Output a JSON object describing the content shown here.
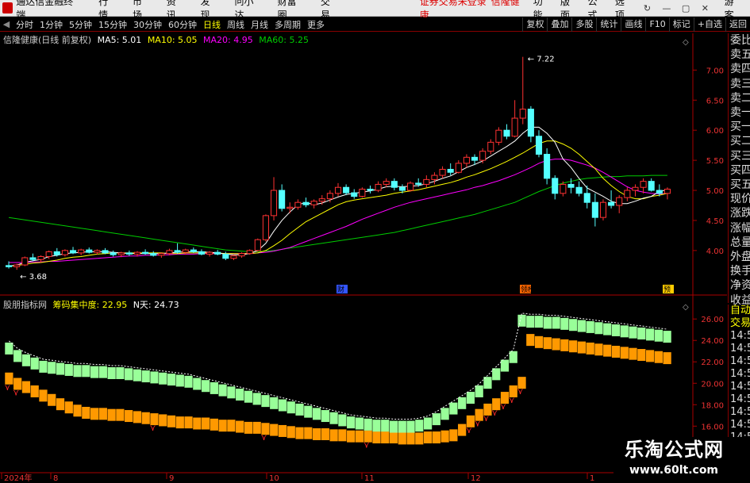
{
  "app": {
    "title": "通达信金融终端",
    "notice": [
      "证券交易未登录",
      "信隆健康"
    ],
    "guest": "游客"
  },
  "menu": [
    "行情",
    "市场",
    "资讯",
    "发现",
    "问小达",
    "财富圈",
    "交易"
  ],
  "menu_right": [
    "功能",
    "版面",
    "公式",
    "选项"
  ],
  "window_buttons": [
    "↻",
    "—",
    "▢",
    "✕"
  ],
  "periods": [
    "分时",
    "1分钟",
    "5分钟",
    "15分钟",
    "30分钟",
    "60分钟",
    "日线",
    "周线",
    "月线",
    "多周期",
    "更多"
  ],
  "active_period": "日线",
  "toolbar_right": [
    "复权",
    "叠加",
    "多股",
    "统计",
    "画线",
    "F10",
    "标记",
    "+自选",
    "返回"
  ],
  "main_info": {
    "name": "信隆健康(日线 前复权)",
    "ma5": "MA5: 5.01",
    "ma10": "MA10: 5.05",
    "ma20": "MA20: 4.95",
    "ma60": "MA60: 5.25"
  },
  "sub_info": {
    "name": "股朋指标网",
    "chip": "筹码集中度: 22.95",
    "nday": "N天: 24.73"
  },
  "order_panel": [
    "委比",
    "卖五",
    "卖四",
    "卖三",
    "卖二",
    "卖一",
    "买一",
    "买二",
    "买三",
    "买四",
    "买五",
    "现价",
    "涨跌",
    "涨幅",
    "总量",
    "外盘",
    "换手",
    "净资",
    "收益"
  ],
  "side_panel2": [
    "自动",
    "交易",
    "14:56",
    "14:56",
    "14:56",
    "14:56",
    "14:56",
    "14:56",
    "14:56",
    "14:56",
    "14:56"
  ],
  "price_axis": [
    "7.00",
    "6.50",
    "6.00",
    "5.50",
    "5.00",
    "4.50",
    "4.00"
  ],
  "sub_axis": [
    "26.00",
    "24.00",
    "22.00",
    "20.00",
    "18.00",
    "16.00"
  ],
  "time_axis": [
    "2024年",
    "8",
    "9",
    "10",
    "11",
    "12",
    "1"
  ],
  "annotations": {
    "high": "7.22",
    "low": "3.68",
    "m1": "财",
    "m2": "领榜",
    "m3": "预"
  },
  "watermark": {
    "line1": "乐淘公式网",
    "line2": "www.60lt.com"
  },
  "colors": {
    "up": "#ff3232",
    "down": "#54ffff",
    "ma5": "#ffffff",
    "ma10": "#ffff00",
    "ma20": "#ff00ff",
    "ma60": "#00cc00",
    "bar_orange": "#ff9900",
    "bar_green": "#99ff99"
  },
  "chart_data": {
    "type": "candlestick",
    "price_range": [
      3.55,
      7.4
    ],
    "candles": [
      {
        "o": 3.75,
        "h": 3.82,
        "l": 3.7,
        "c": 3.73
      },
      {
        "o": 3.73,
        "h": 3.78,
        "l": 3.68,
        "c": 3.76
      },
      {
        "o": 3.76,
        "h": 3.9,
        "l": 3.74,
        "c": 3.88
      },
      {
        "o": 3.88,
        "h": 3.95,
        "l": 3.82,
        "c": 3.85
      },
      {
        "o": 3.85,
        "h": 3.92,
        "l": 3.8,
        "c": 3.9
      },
      {
        "o": 3.9,
        "h": 4.0,
        "l": 3.86,
        "c": 3.98
      },
      {
        "o": 3.98,
        "h": 4.04,
        "l": 3.9,
        "c": 3.93
      },
      {
        "o": 3.93,
        "h": 4.02,
        "l": 3.9,
        "c": 4.0
      },
      {
        "o": 4.0,
        "h": 4.06,
        "l": 3.94,
        "c": 3.96
      },
      {
        "o": 3.96,
        "h": 4.03,
        "l": 3.92,
        "c": 4.01
      },
      {
        "o": 4.01,
        "h": 4.05,
        "l": 3.95,
        "c": 3.97
      },
      {
        "o": 3.97,
        "h": 4.02,
        "l": 3.93,
        "c": 4.0
      },
      {
        "o": 4.0,
        "h": 4.04,
        "l": 3.94,
        "c": 3.96
      },
      {
        "o": 3.96,
        "h": 4.0,
        "l": 3.9,
        "c": 3.93
      },
      {
        "o": 3.93,
        "h": 3.98,
        "l": 3.89,
        "c": 3.96
      },
      {
        "o": 3.96,
        "h": 4.0,
        "l": 3.91,
        "c": 3.94
      },
      {
        "o": 3.94,
        "h": 3.99,
        "l": 3.9,
        "c": 3.97
      },
      {
        "o": 3.97,
        "h": 4.02,
        "l": 3.93,
        "c": 3.95
      },
      {
        "o": 3.95,
        "h": 3.99,
        "l": 3.9,
        "c": 3.92
      },
      {
        "o": 3.92,
        "h": 3.97,
        "l": 3.88,
        "c": 3.95
      },
      {
        "o": 3.95,
        "h": 4.03,
        "l": 3.92,
        "c": 4.0
      },
      {
        "o": 4.0,
        "h": 4.12,
        "l": 3.95,
        "c": 3.97
      },
      {
        "o": 3.97,
        "h": 4.03,
        "l": 3.93,
        "c": 4.01
      },
      {
        "o": 4.01,
        "h": 4.05,
        "l": 3.96,
        "c": 3.98
      },
      {
        "o": 3.98,
        "h": 4.02,
        "l": 3.92,
        "c": 3.94
      },
      {
        "o": 3.94,
        "h": 3.99,
        "l": 3.9,
        "c": 3.97
      },
      {
        "o": 3.97,
        "h": 4.01,
        "l": 3.92,
        "c": 3.94
      },
      {
        "o": 3.94,
        "h": 3.98,
        "l": 3.84,
        "c": 3.87
      },
      {
        "o": 3.87,
        "h": 3.93,
        "l": 3.84,
        "c": 3.91
      },
      {
        "o": 3.91,
        "h": 3.97,
        "l": 3.88,
        "c": 3.95
      },
      {
        "o": 3.95,
        "h": 4.02,
        "l": 3.93,
        "c": 4.0
      },
      {
        "o": 4.0,
        "h": 4.2,
        "l": 3.98,
        "c": 4.18
      },
      {
        "o": 4.18,
        "h": 4.6,
        "l": 4.15,
        "c": 4.58
      },
      {
        "o": 4.58,
        "h": 5.22,
        "l": 4.5,
        "c": 5.0
      },
      {
        "o": 5.0,
        "h": 5.1,
        "l": 4.65,
        "c": 4.7
      },
      {
        "o": 4.7,
        "h": 4.8,
        "l": 4.62,
        "c": 4.72
      },
      {
        "o": 4.72,
        "h": 4.85,
        "l": 4.68,
        "c": 4.8
      },
      {
        "o": 4.8,
        "h": 4.88,
        "l": 4.72,
        "c": 4.76
      },
      {
        "o": 4.76,
        "h": 4.85,
        "l": 4.7,
        "c": 4.82
      },
      {
        "o": 4.82,
        "h": 4.92,
        "l": 4.76,
        "c": 4.86
      },
      {
        "o": 4.86,
        "h": 5.0,
        "l": 4.8,
        "c": 4.95
      },
      {
        "o": 4.95,
        "h": 5.12,
        "l": 4.9,
        "c": 5.05
      },
      {
        "o": 5.05,
        "h": 5.1,
        "l": 4.92,
        "c": 4.96
      },
      {
        "o": 4.96,
        "h": 5.02,
        "l": 4.86,
        "c": 4.9
      },
      {
        "o": 4.9,
        "h": 5.05,
        "l": 4.88,
        "c": 5.02
      },
      {
        "o": 5.02,
        "h": 5.08,
        "l": 4.95,
        "c": 5.0
      },
      {
        "o": 5.0,
        "h": 5.15,
        "l": 4.97,
        "c": 5.1
      },
      {
        "o": 5.1,
        "h": 5.2,
        "l": 5.05,
        "c": 5.15
      },
      {
        "o": 5.15,
        "h": 5.2,
        "l": 5.0,
        "c": 5.05
      },
      {
        "o": 5.05,
        "h": 5.1,
        "l": 4.95,
        "c": 5.0
      },
      {
        "o": 5.0,
        "h": 5.15,
        "l": 4.98,
        "c": 5.12
      },
      {
        "o": 5.12,
        "h": 5.2,
        "l": 5.06,
        "c": 5.1
      },
      {
        "o": 5.1,
        "h": 5.25,
        "l": 5.05,
        "c": 5.18
      },
      {
        "o": 5.18,
        "h": 5.3,
        "l": 5.1,
        "c": 5.25
      },
      {
        "o": 5.25,
        "h": 5.4,
        "l": 5.2,
        "c": 5.35
      },
      {
        "o": 5.35,
        "h": 5.45,
        "l": 5.25,
        "c": 5.3
      },
      {
        "o": 5.3,
        "h": 5.5,
        "l": 5.28,
        "c": 5.45
      },
      {
        "o": 5.45,
        "h": 5.6,
        "l": 5.38,
        "c": 5.55
      },
      {
        "o": 5.55,
        "h": 5.6,
        "l": 5.42,
        "c": 5.5
      },
      {
        "o": 5.5,
        "h": 5.7,
        "l": 5.45,
        "c": 5.65
      },
      {
        "o": 5.65,
        "h": 5.85,
        "l": 5.6,
        "c": 5.8
      },
      {
        "o": 5.8,
        "h": 6.05,
        "l": 5.75,
        "c": 6.0
      },
      {
        "o": 6.0,
        "h": 6.1,
        "l": 5.85,
        "c": 5.9
      },
      {
        "o": 5.9,
        "h": 6.5,
        "l": 5.88,
        "c": 6.2
      },
      {
        "o": 6.2,
        "h": 7.22,
        "l": 6.1,
        "c": 6.35
      },
      {
        "o": 6.35,
        "h": 6.4,
        "l": 5.8,
        "c": 5.9
      },
      {
        "o": 5.9,
        "h": 6.0,
        "l": 5.55,
        "c": 5.6
      },
      {
        "o": 5.6,
        "h": 5.7,
        "l": 5.1,
        "c": 5.2
      },
      {
        "o": 5.2,
        "h": 5.25,
        "l": 4.85,
        "c": 4.95
      },
      {
        "o": 4.95,
        "h": 5.15,
        "l": 4.9,
        "c": 5.1
      },
      {
        "o": 5.1,
        "h": 5.2,
        "l": 4.95,
        "c": 5.05
      },
      {
        "o": 5.05,
        "h": 5.15,
        "l": 4.9,
        "c": 4.95
      },
      {
        "o": 4.95,
        "h": 5.08,
        "l": 4.7,
        "c": 4.8
      },
      {
        "o": 4.8,
        "h": 4.95,
        "l": 4.4,
        "c": 4.55
      },
      {
        "o": 4.55,
        "h": 4.85,
        "l": 4.5,
        "c": 4.8
      },
      {
        "o": 4.8,
        "h": 5.0,
        "l": 4.7,
        "c": 4.75
      },
      {
        "o": 4.75,
        "h": 4.92,
        "l": 4.62,
        "c": 4.88
      },
      {
        "o": 4.88,
        "h": 5.05,
        "l": 4.82,
        "c": 5.0
      },
      {
        "o": 5.0,
        "h": 5.1,
        "l": 4.9,
        "c": 5.05
      },
      {
        "o": 5.05,
        "h": 5.2,
        "l": 4.95,
        "c": 5.15
      },
      {
        "o": 5.15,
        "h": 5.2,
        "l": 4.98,
        "c": 5.0
      },
      {
        "o": 5.0,
        "h": 5.1,
        "l": 4.9,
        "c": 4.95
      },
      {
        "o": 4.95,
        "h": 5.05,
        "l": 4.85,
        "c": 5.02
      }
    ],
    "ma5": [
      3.74,
      3.76,
      3.8,
      3.83,
      3.85,
      3.9,
      3.92,
      3.95,
      3.96,
      3.97,
      3.98,
      3.98,
      3.98,
      3.97,
      3.96,
      3.95,
      3.95,
      3.95,
      3.95,
      3.95,
      3.96,
      3.97,
      3.98,
      3.98,
      3.98,
      3.97,
      3.96,
      3.94,
      3.93,
      3.93,
      3.95,
      4.0,
      4.12,
      4.32,
      4.5,
      4.64,
      4.76,
      4.8,
      4.76,
      4.79,
      4.84,
      4.89,
      4.93,
      4.95,
      4.97,
      4.99,
      5.02,
      5.06,
      5.07,
      5.06,
      5.07,
      5.08,
      5.11,
      5.15,
      5.2,
      5.24,
      5.31,
      5.38,
      5.43,
      5.49,
      5.57,
      5.65,
      5.73,
      5.82,
      5.95,
      6.05,
      6.05,
      5.95,
      5.8,
      5.52,
      5.38,
      5.2,
      5.04,
      4.97,
      4.9,
      4.82,
      4.78,
      4.78,
      4.82,
      4.87,
      4.9,
      4.98,
      5.01
    ],
    "ma10": [
      3.74,
      3.75,
      3.77,
      3.79,
      3.8,
      3.82,
      3.84,
      3.87,
      3.89,
      3.9,
      3.92,
      3.94,
      3.95,
      3.96,
      3.96,
      3.96,
      3.96,
      3.96,
      3.96,
      3.96,
      3.95,
      3.95,
      3.96,
      3.96,
      3.96,
      3.96,
      3.96,
      3.95,
      3.95,
      3.95,
      3.95,
      3.96,
      4.0,
      4.08,
      4.17,
      4.28,
      4.38,
      4.48,
      4.55,
      4.62,
      4.69,
      4.76,
      4.81,
      4.84,
      4.86,
      4.88,
      4.9,
      4.92,
      4.95,
      4.97,
      4.99,
      5.01,
      5.04,
      5.07,
      5.1,
      5.13,
      5.17,
      5.22,
      5.26,
      5.31,
      5.36,
      5.42,
      5.48,
      5.55,
      5.62,
      5.7,
      5.78,
      5.82,
      5.82,
      5.77,
      5.7,
      5.6,
      5.48,
      5.36,
      5.2,
      5.08,
      4.98,
      4.9,
      4.86,
      4.86,
      4.9,
      4.92,
      4.95
    ],
    "ma20": [
      3.8,
      3.8,
      3.8,
      3.81,
      3.81,
      3.82,
      3.82,
      3.83,
      3.84,
      3.85,
      3.86,
      3.87,
      3.88,
      3.89,
      3.9,
      3.91,
      3.91,
      3.92,
      3.92,
      3.93,
      3.93,
      3.94,
      3.94,
      3.94,
      3.95,
      3.95,
      3.95,
      3.95,
      3.95,
      3.95,
      3.95,
      3.96,
      3.97,
      3.99,
      4.02,
      4.05,
      4.1,
      4.15,
      4.2,
      4.25,
      4.3,
      4.35,
      4.4,
      4.46,
      4.52,
      4.57,
      4.62,
      4.67,
      4.72,
      4.76,
      4.8,
      4.83,
      4.86,
      4.89,
      4.92,
      4.95,
      4.98,
      5.01,
      5.05,
      5.08,
      5.12,
      5.16,
      5.21,
      5.26,
      5.32,
      5.38,
      5.45,
      5.5,
      5.52,
      5.52,
      5.5,
      5.46,
      5.42,
      5.37,
      5.3,
      5.22,
      5.14,
      5.06,
      5.0,
      4.97,
      4.95,
      4.94,
      4.95
    ],
    "ma60": [
      4.55,
      4.53,
      4.51,
      4.49,
      4.47,
      4.45,
      4.43,
      4.41,
      4.39,
      4.37,
      4.35,
      4.33,
      4.31,
      4.29,
      4.27,
      4.25,
      4.23,
      4.21,
      4.19,
      4.17,
      4.15,
      4.13,
      4.11,
      4.09,
      4.07,
      4.05,
      4.03,
      4.01,
      4.0,
      3.99,
      3.98,
      3.98,
      3.99,
      4.0,
      4.02,
      4.04,
      4.06,
      4.08,
      4.1,
      4.12,
      4.14,
      4.16,
      4.18,
      4.2,
      4.22,
      4.24,
      4.26,
      4.28,
      4.3,
      4.33,
      4.36,
      4.39,
      4.42,
      4.45,
      4.48,
      4.51,
      4.54,
      4.57,
      4.6,
      4.64,
      4.68,
      4.72,
      4.76,
      4.8,
      4.86,
      4.92,
      4.98,
      5.03,
      5.08,
      5.12,
      5.15,
      5.18,
      5.2,
      5.21,
      5.22,
      5.23,
      5.23,
      5.24,
      5.24,
      5.24,
      5.25,
      5.25,
      5.25
    ],
    "indicator": {
      "range": [
        15.8,
        27.2
      ],
      "orange": [
        21.0,
        20.5,
        20.2,
        19.8,
        19.4,
        19.0,
        18.6,
        18.3,
        18.0,
        17.8,
        17.7,
        17.7,
        17.6,
        17.6,
        17.5,
        17.4,
        17.3,
        17.2,
        17.1,
        17.0,
        16.9,
        16.9,
        16.8,
        16.8,
        16.7,
        16.6,
        16.6,
        16.5,
        16.4,
        16.4,
        16.3,
        16.2,
        16.1,
        16.0,
        15.9,
        15.9,
        15.8,
        15.8,
        15.7,
        15.7,
        15.6,
        15.6,
        15.6,
        15.5,
        15.5,
        15.5,
        15.4,
        15.4,
        15.4,
        15.5,
        15.5,
        15.6,
        15.7,
        16.2,
        17.0,
        17.6,
        18.1,
        18.6,
        19.2,
        19.8,
        20.6,
        24.6,
        24.4,
        24.3,
        24.2,
        24.1,
        24.0,
        23.9,
        23.8,
        23.7,
        23.6,
        23.5,
        23.4,
        23.3,
        23.2,
        23.1,
        23.0,
        22.9
      ],
      "green": [
        23.8,
        23.1,
        22.7,
        22.4,
        22.1,
        22.0,
        21.9,
        21.8,
        21.7,
        21.7,
        21.6,
        21.6,
        21.5,
        21.5,
        21.4,
        21.3,
        21.2,
        21.1,
        21.0,
        20.9,
        20.8,
        20.7,
        20.5,
        20.3,
        20.1,
        19.9,
        19.7,
        19.5,
        19.3,
        19.1,
        18.9,
        18.7,
        18.5,
        18.3,
        18.1,
        17.9,
        17.7,
        17.5,
        17.3,
        17.1,
        16.9,
        16.8,
        16.7,
        16.6,
        16.6,
        16.5,
        16.5,
        16.5,
        16.6,
        16.8,
        17.2,
        17.7,
        18.2,
        18.7,
        19.2,
        19.8,
        20.6,
        21.4,
        22.2,
        23.0,
        26.4,
        26.3,
        26.3,
        26.2,
        26.2,
        26.1,
        26.0,
        25.9,
        25.8,
        25.7,
        25.6,
        25.5,
        25.4,
        25.3,
        25.2,
        25.1,
        25.0,
        24.9
      ],
      "arrows_idx": [
        0,
        1,
        17,
        30,
        42,
        54,
        55,
        56,
        57,
        58,
        59,
        60
      ]
    }
  }
}
